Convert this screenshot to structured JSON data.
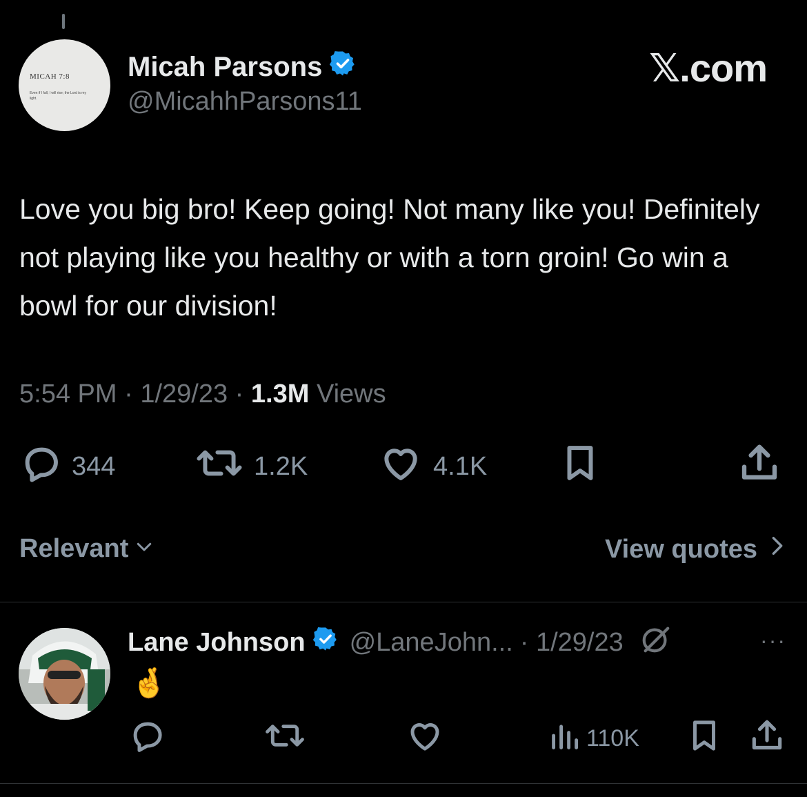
{
  "header": {
    "watermark": "𝕏.com"
  },
  "tweet": {
    "author_name": "Micah Parsons",
    "author_handle": "@MicahhParsons11",
    "avatar_text": "MICAH 7:8",
    "avatar_subtext": "Even if I fall, I will rise; the Lord is my light.",
    "verified": true,
    "text": "Love you big bro! Keep going! Not many like you! Definitely not playing like you healthy or with a torn groin! Go win a bowl for our division!",
    "time": "5:54 PM",
    "date": "1/29/23",
    "views_count": "1.3M",
    "views_label": "Views",
    "separator": "·",
    "replies": "344",
    "reposts": "1.2K",
    "likes": "4.1K"
  },
  "filters": {
    "sort_label": "Relevant",
    "view_quotes_label": "View quotes"
  },
  "reply": {
    "author_name": "Lane Johnson",
    "author_handle": "@LaneJohn...",
    "date": "· 1/29/23",
    "verified": true,
    "text": "🤞",
    "views": "110K",
    "more": "···"
  },
  "colors": {
    "background": "#000000",
    "text": "#e7e9ea",
    "muted": "#71767b",
    "verified": "#1d9bf0"
  }
}
